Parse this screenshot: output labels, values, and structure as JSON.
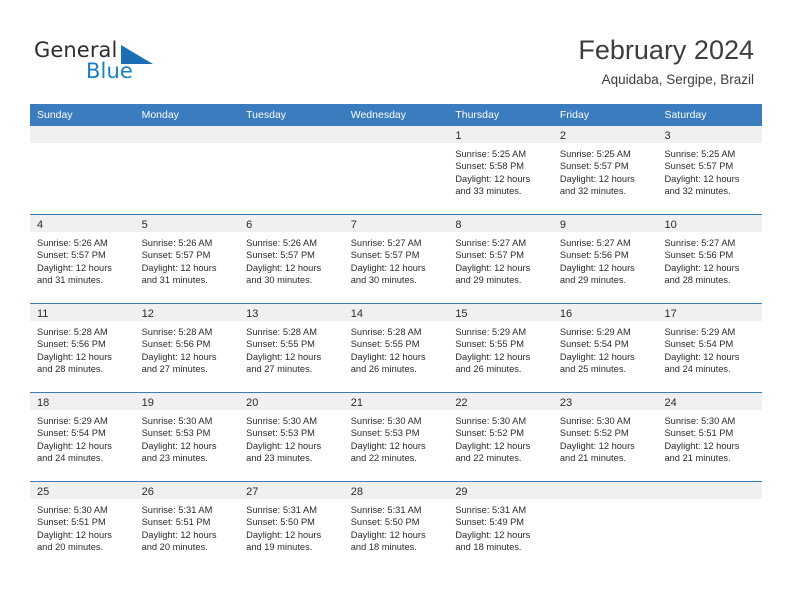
{
  "brand": {
    "name_top": "General",
    "name_bottom": "Blue",
    "accent_color": "#1c6eb4",
    "triangle_icon": "triangle-icon"
  },
  "header": {
    "title": "February 2024",
    "subtitle": "Aquidaba, Sergipe, Brazil"
  },
  "calendar": {
    "header_bg": "#3a7cbe",
    "header_text_color": "#ffffff",
    "day_band_bg": "#f0f0f0",
    "weekdays": [
      "Sunday",
      "Monday",
      "Tuesday",
      "Wednesday",
      "Thursday",
      "Friday",
      "Saturday"
    ],
    "weeks": [
      [
        {
          "day": "",
          "empty": true
        },
        {
          "day": "",
          "empty": true
        },
        {
          "day": "",
          "empty": true
        },
        {
          "day": "",
          "empty": true
        },
        {
          "day": "1",
          "sunrise": "Sunrise: 5:25 AM",
          "sunset": "Sunset: 5:58 PM",
          "daylight": "Daylight: 12 hours and 33 minutes."
        },
        {
          "day": "2",
          "sunrise": "Sunrise: 5:25 AM",
          "sunset": "Sunset: 5:57 PM",
          "daylight": "Daylight: 12 hours and 32 minutes."
        },
        {
          "day": "3",
          "sunrise": "Sunrise: 5:25 AM",
          "sunset": "Sunset: 5:57 PM",
          "daylight": "Daylight: 12 hours and 32 minutes."
        }
      ],
      [
        {
          "day": "4",
          "sunrise": "Sunrise: 5:26 AM",
          "sunset": "Sunset: 5:57 PM",
          "daylight": "Daylight: 12 hours and 31 minutes."
        },
        {
          "day": "5",
          "sunrise": "Sunrise: 5:26 AM",
          "sunset": "Sunset: 5:57 PM",
          "daylight": "Daylight: 12 hours and 31 minutes."
        },
        {
          "day": "6",
          "sunrise": "Sunrise: 5:26 AM",
          "sunset": "Sunset: 5:57 PM",
          "daylight": "Daylight: 12 hours and 30 minutes."
        },
        {
          "day": "7",
          "sunrise": "Sunrise: 5:27 AM",
          "sunset": "Sunset: 5:57 PM",
          "daylight": "Daylight: 12 hours and 30 minutes."
        },
        {
          "day": "8",
          "sunrise": "Sunrise: 5:27 AM",
          "sunset": "Sunset: 5:57 PM",
          "daylight": "Daylight: 12 hours and 29 minutes."
        },
        {
          "day": "9",
          "sunrise": "Sunrise: 5:27 AM",
          "sunset": "Sunset: 5:56 PM",
          "daylight": "Daylight: 12 hours and 29 minutes."
        },
        {
          "day": "10",
          "sunrise": "Sunrise: 5:27 AM",
          "sunset": "Sunset: 5:56 PM",
          "daylight": "Daylight: 12 hours and 28 minutes."
        }
      ],
      [
        {
          "day": "11",
          "sunrise": "Sunrise: 5:28 AM",
          "sunset": "Sunset: 5:56 PM",
          "daylight": "Daylight: 12 hours and 28 minutes."
        },
        {
          "day": "12",
          "sunrise": "Sunrise: 5:28 AM",
          "sunset": "Sunset: 5:56 PM",
          "daylight": "Daylight: 12 hours and 27 minutes."
        },
        {
          "day": "13",
          "sunrise": "Sunrise: 5:28 AM",
          "sunset": "Sunset: 5:55 PM",
          "daylight": "Daylight: 12 hours and 27 minutes."
        },
        {
          "day": "14",
          "sunrise": "Sunrise: 5:28 AM",
          "sunset": "Sunset: 5:55 PM",
          "daylight": "Daylight: 12 hours and 26 minutes."
        },
        {
          "day": "15",
          "sunrise": "Sunrise: 5:29 AM",
          "sunset": "Sunset: 5:55 PM",
          "daylight": "Daylight: 12 hours and 26 minutes."
        },
        {
          "day": "16",
          "sunrise": "Sunrise: 5:29 AM",
          "sunset": "Sunset: 5:54 PM",
          "daylight": "Daylight: 12 hours and 25 minutes."
        },
        {
          "day": "17",
          "sunrise": "Sunrise: 5:29 AM",
          "sunset": "Sunset: 5:54 PM",
          "daylight": "Daylight: 12 hours and 24 minutes."
        }
      ],
      [
        {
          "day": "18",
          "sunrise": "Sunrise: 5:29 AM",
          "sunset": "Sunset: 5:54 PM",
          "daylight": "Daylight: 12 hours and 24 minutes."
        },
        {
          "day": "19",
          "sunrise": "Sunrise: 5:30 AM",
          "sunset": "Sunset: 5:53 PM",
          "daylight": "Daylight: 12 hours and 23 minutes."
        },
        {
          "day": "20",
          "sunrise": "Sunrise: 5:30 AM",
          "sunset": "Sunset: 5:53 PM",
          "daylight": "Daylight: 12 hours and 23 minutes."
        },
        {
          "day": "21",
          "sunrise": "Sunrise: 5:30 AM",
          "sunset": "Sunset: 5:53 PM",
          "daylight": "Daylight: 12 hours and 22 minutes."
        },
        {
          "day": "22",
          "sunrise": "Sunrise: 5:30 AM",
          "sunset": "Sunset: 5:52 PM",
          "daylight": "Daylight: 12 hours and 22 minutes."
        },
        {
          "day": "23",
          "sunrise": "Sunrise: 5:30 AM",
          "sunset": "Sunset: 5:52 PM",
          "daylight": "Daylight: 12 hours and 21 minutes."
        },
        {
          "day": "24",
          "sunrise": "Sunrise: 5:30 AM",
          "sunset": "Sunset: 5:51 PM",
          "daylight": "Daylight: 12 hours and 21 minutes."
        }
      ],
      [
        {
          "day": "25",
          "sunrise": "Sunrise: 5:30 AM",
          "sunset": "Sunset: 5:51 PM",
          "daylight": "Daylight: 12 hours and 20 minutes."
        },
        {
          "day": "26",
          "sunrise": "Sunrise: 5:31 AM",
          "sunset": "Sunset: 5:51 PM",
          "daylight": "Daylight: 12 hours and 20 minutes."
        },
        {
          "day": "27",
          "sunrise": "Sunrise: 5:31 AM",
          "sunset": "Sunset: 5:50 PM",
          "daylight": "Daylight: 12 hours and 19 minutes."
        },
        {
          "day": "28",
          "sunrise": "Sunrise: 5:31 AM",
          "sunset": "Sunset: 5:50 PM",
          "daylight": "Daylight: 12 hours and 18 minutes."
        },
        {
          "day": "29",
          "sunrise": "Sunrise: 5:31 AM",
          "sunset": "Sunset: 5:49 PM",
          "daylight": "Daylight: 12 hours and 18 minutes."
        },
        {
          "day": "",
          "empty": true
        },
        {
          "day": "",
          "empty": true
        }
      ]
    ]
  }
}
